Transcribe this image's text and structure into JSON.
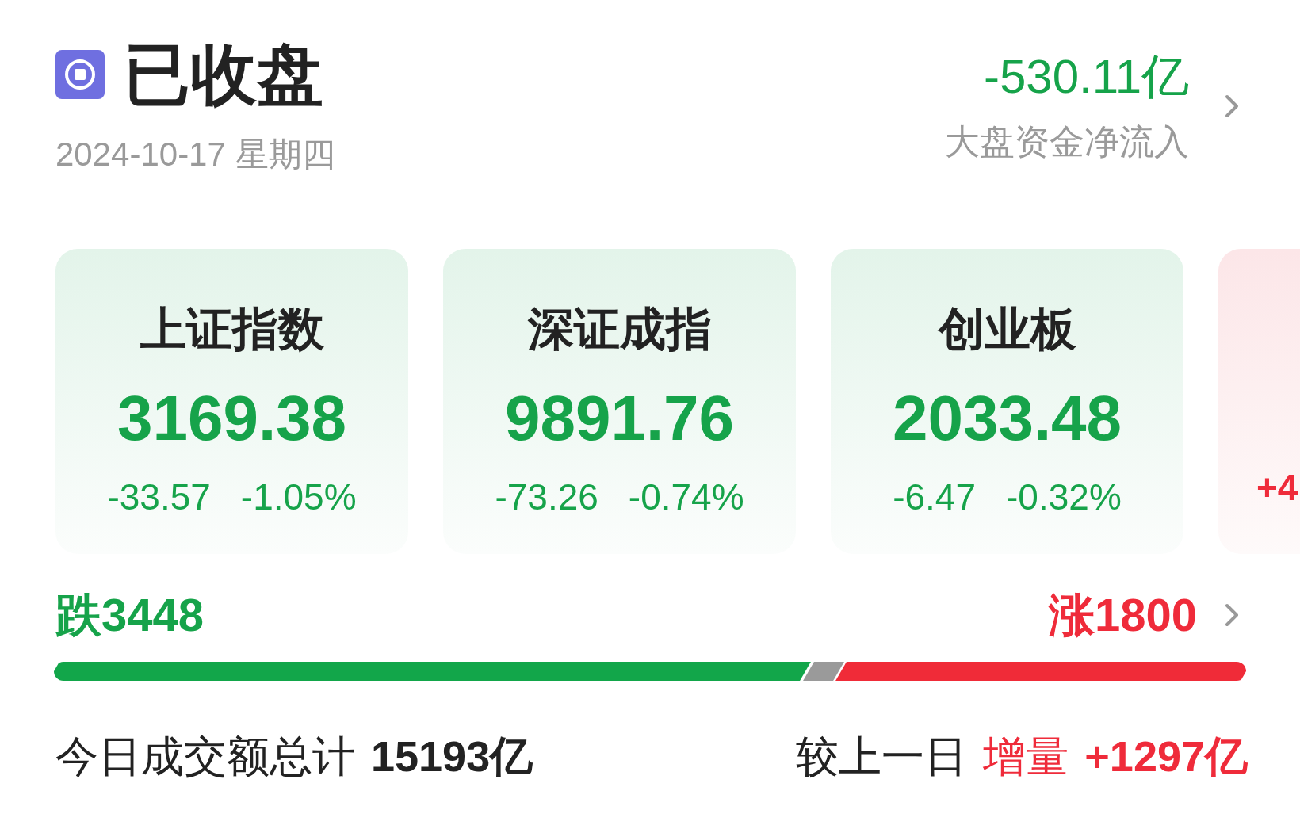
{
  "header": {
    "status": "已收盘",
    "date": "2024-10-17 星期四",
    "net_flow": {
      "value": "-530.11亿",
      "rising": false,
      "label": "大盘资金净流入"
    }
  },
  "indices": [
    {
      "kind": "full",
      "rising": false,
      "name": "上证指数",
      "value": "3169.38",
      "change": "-33.57",
      "percent": "-1.05%"
    },
    {
      "kind": "full",
      "rising": false,
      "name": "深证成指",
      "value": "9891.76",
      "change": "-73.26",
      "percent": "-0.74%"
    },
    {
      "kind": "full",
      "rising": false,
      "name": "创业板",
      "value": "2033.48",
      "change": "-6.47",
      "percent": "-0.32%"
    },
    {
      "kind": "cut",
      "rising": true,
      "change": "+4"
    }
  ],
  "breadth": {
    "fall_label": "跌3448",
    "rise_label": "涨1800"
  },
  "turnover": {
    "label": "今日成交额总计",
    "value": "15193亿",
    "compare_label": "较上一日",
    "change_label": "增量",
    "change_value": "+1297亿"
  }
}
